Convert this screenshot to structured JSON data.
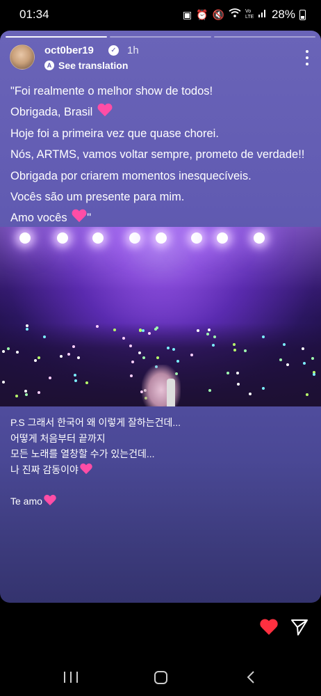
{
  "status_bar": {
    "time": "01:34",
    "battery": "28%",
    "icons": [
      "save-icon",
      "alarm-icon",
      "mute-icon",
      "wifi-icon",
      "volte-icon",
      "signal-icon",
      "battery-icon"
    ],
    "volte_label": "Vo LTE"
  },
  "story": {
    "username": "oct0ber19",
    "time_ago": "1h",
    "see_translation": "See translation",
    "caption_lines": [
      "\"Foi realmente o melhor show de todos!",
      "Obrigada, Brasil",
      "Hoje foi a primeira vez que quase chorei.",
      "Nós, ARTMS, vamos voltar sempre, prometo de verdade!!",
      "Obrigada por criarem momentos inesquecíveis.",
      "Vocês são um presente para mim.",
      "Amo vocês",
      "\""
    ],
    "ps_lines": [
      "P.S 그래서 한국어 왜 이렇게 잘하는건데...",
      "어떻게 처음부터 끝까지",
      "모든 노래를 열창할 수가 있는건데...",
      "나 진짜 감동이야",
      "Te amo"
    ],
    "heart_emoji": "pink-heart",
    "progress_segments": 3,
    "active_segment": 1
  },
  "footer": {
    "like_icon": "heart-icon",
    "share_icon": "send-icon",
    "like_color": "#ff3040"
  },
  "colors": {
    "card_top": "#6a64b8",
    "card_bottom": "#34336e",
    "heart_emoji": "#ff4da6"
  }
}
